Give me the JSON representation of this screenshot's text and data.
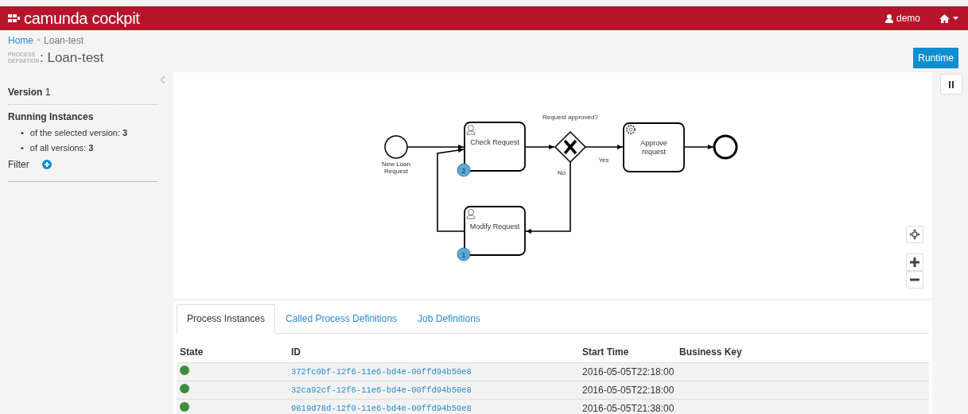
{
  "navbar": {
    "brand": "camunda cockpit",
    "user": "demo"
  },
  "breadcrumb": {
    "items": [
      "Home",
      "Loan-test"
    ],
    "separator": "»"
  },
  "header": {
    "label": "PROCESS DEFINITION",
    "title": ": Loan-test",
    "button": "Runtime"
  },
  "sidebar": {
    "version_label": "Version",
    "version": "1",
    "instances_title": "Running Instances",
    "bullet": "•",
    "instances": [
      {
        "label": "of the selected version:",
        "value": "3"
      },
      {
        "label": "of all versions:",
        "value": "3"
      }
    ],
    "filter": "Filter"
  },
  "diagram": {
    "nodes": [
      {
        "kind": "start",
        "label": "New Loan Request"
      },
      {
        "kind": "user-task",
        "label": "Check Request",
        "badge": "2"
      },
      {
        "kind": "gateway",
        "label": "Request approved?"
      },
      {
        "kind": "service-task",
        "label": "Approve request"
      },
      {
        "kind": "end"
      },
      {
        "kind": "user-task",
        "label": "Modify Request",
        "badge": "1"
      }
    ],
    "flow_labels": [
      "Yes",
      "No"
    ]
  },
  "tabs": [
    {
      "label": "Process Instances",
      "selected": true
    },
    {
      "label": "Called Process Definitions",
      "selected": false
    },
    {
      "label": "Job Definitions",
      "selected": false
    }
  ],
  "table": {
    "columns": [
      "State",
      "ID",
      "Start Time",
      "Business Key"
    ],
    "rows": [
      {
        "color": "#3f8c3f",
        "id": "372fc0bf-12f6-11e6-bd4e-00ffd94b50e8",
        "start": "2016-05-05T22:18:00"
      },
      {
        "color": "#3f8c3f",
        "id": "32ca92cf-12f6-11e6-bd4e-00ffd94b50e8",
        "start": "2016-05-05T22:18:00"
      },
      {
        "color": "#3f8c3f",
        "id": "9819d78d-12f0-11e6-bd4e-00ffd94b50e8",
        "start": "2016-05-05T21:38:00"
      }
    ]
  }
}
